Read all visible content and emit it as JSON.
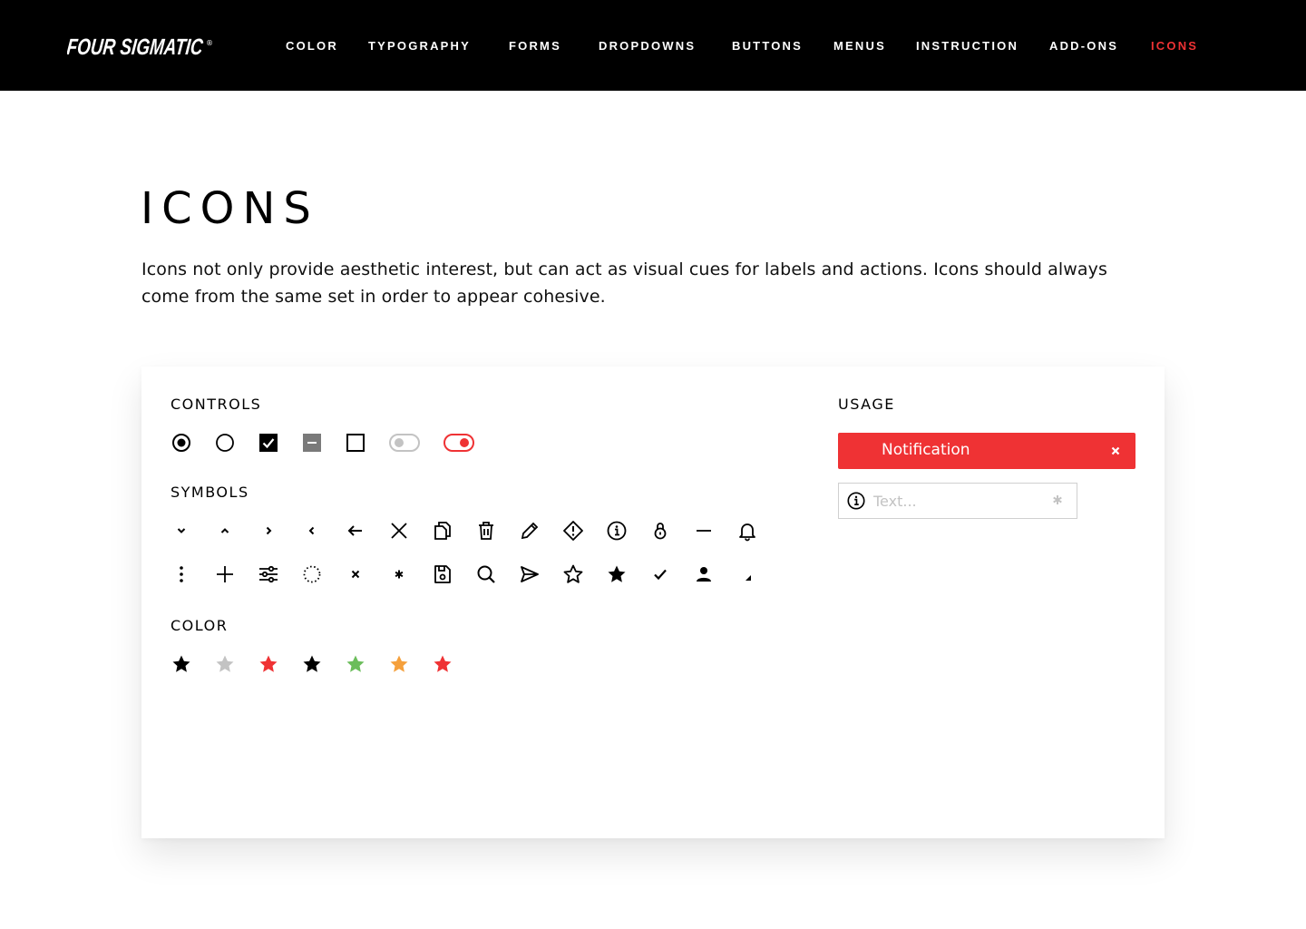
{
  "brand": {
    "name": "FOUR SIGMATIC",
    "registered_mark": "®"
  },
  "nav": {
    "items": [
      {
        "label": "COLOR",
        "active": false
      },
      {
        "label": "TYPOGRAPHY",
        "active": false
      },
      {
        "label": "FORMS",
        "active": false
      },
      {
        "label": "DROPDOWNS",
        "active": false
      },
      {
        "label": "BUTTONS",
        "active": false
      },
      {
        "label": "MENUS",
        "active": false
      },
      {
        "label": "INSTRUCTION",
        "active": false
      },
      {
        "label": "ADD-ONS",
        "active": false
      },
      {
        "label": "ICONS",
        "active": true
      }
    ]
  },
  "page": {
    "title": "ICONS",
    "intro": "Icons not only provide aesthetic interest, but can act as visual cues for labels and actions. Icons should always come from the same set in order to appear cohesive."
  },
  "card": {
    "controls": {
      "label": "CONTROLS",
      "icons": [
        "radio-checked-icon",
        "radio-unchecked-icon",
        "checkbox-checked-icon",
        "checkbox-indeterminate-icon",
        "checkbox-unchecked-icon",
        "toggle-off-icon",
        "toggle-on-icon"
      ]
    },
    "symbols": {
      "label": "SYMBOLS",
      "row1": [
        "chevron-down-icon",
        "chevron-up-icon",
        "chevron-right-icon",
        "chevron-left-icon",
        "arrow-left-icon",
        "close-icon",
        "copy-icon",
        "trash-icon",
        "pencil-icon",
        "warning-icon",
        "info-icon",
        "lock-icon",
        "minus-icon",
        "bell-icon"
      ],
      "row2": [
        "more-vertical-icon",
        "plus-icon",
        "sliders-icon",
        "spinner-icon",
        "small-close-icon",
        "asterisk-icon",
        "save-icon",
        "search-icon",
        "send-icon",
        "star-outline-icon",
        "star-filled-icon",
        "check-icon",
        "user-icon",
        "corner-triangle-icon"
      ]
    },
    "color": {
      "label": "COLOR",
      "stars": [
        "#000000",
        "#c3c3c3",
        "#ef3234",
        "#000000",
        "#6bbd5b",
        "#f5a03c",
        "#ef3234"
      ]
    },
    "usage": {
      "label": "USAGE",
      "notification_text": "Notification",
      "text_placeholder": "Text..."
    }
  },
  "colors": {
    "accent": "#ef3234",
    "toggle_off": "#c3c3c3",
    "indeterminate": "#7a7a7a"
  }
}
